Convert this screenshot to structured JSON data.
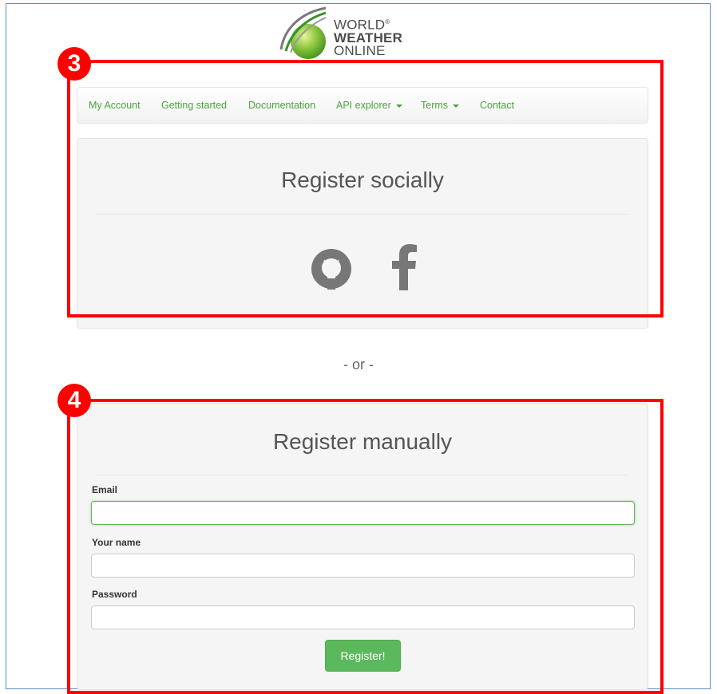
{
  "logo": {
    "line1": "WORLD",
    "registered": "®",
    "line2": "WEATHER",
    "line3": "ONLINE"
  },
  "nav": {
    "items": [
      {
        "label": "My Account",
        "has_caret": false
      },
      {
        "label": "Getting started",
        "has_caret": false
      },
      {
        "label": "Documentation",
        "has_caret": false
      },
      {
        "label": "API explorer",
        "has_caret": true
      },
      {
        "label": "Terms",
        "has_caret": true
      },
      {
        "label": "Contact",
        "has_caret": false
      }
    ]
  },
  "social": {
    "title": "Register socially",
    "icons": [
      "github-icon",
      "facebook-icon"
    ]
  },
  "separator": "- or -",
  "manual": {
    "title": "Register manually",
    "email_label": "Email",
    "email_value": "",
    "name_label": "Your name",
    "name_value": "",
    "password_label": "Password",
    "password_value": "",
    "submit_label": "Register!"
  },
  "annotations": {
    "social_badge": "3",
    "manual_badge": "4"
  },
  "colors": {
    "accent": "#4aa43a",
    "button": "#5cb85c",
    "annotation": "#ff0000"
  }
}
